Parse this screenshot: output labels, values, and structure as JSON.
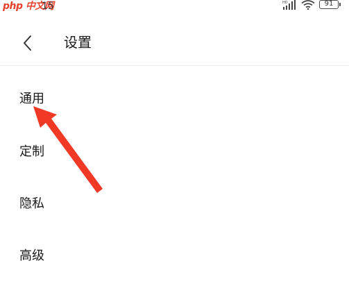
{
  "status_bar": {
    "watermark": "php 中文网",
    "time": "15",
    "signal_icon": "signal-hd-icon",
    "wifi_icon": "wifi-icon",
    "battery": "91"
  },
  "header": {
    "back_icon": "chevron-left-icon",
    "title": "设置"
  },
  "menu": {
    "items": [
      {
        "label": "通用"
      },
      {
        "label": "定制"
      },
      {
        "label": "隐私"
      },
      {
        "label": "高级"
      }
    ]
  },
  "annotation": {
    "arrow_color": "#f03a26"
  }
}
